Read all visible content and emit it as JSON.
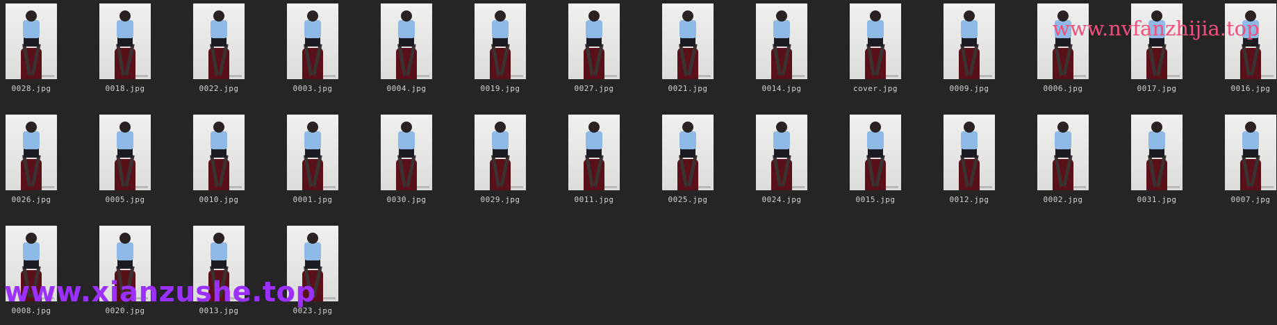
{
  "files": [
    {
      "name": "0028.jpg"
    },
    {
      "name": "0018.jpg"
    },
    {
      "name": "0022.jpg"
    },
    {
      "name": "0003.jpg"
    },
    {
      "name": "0004.jpg"
    },
    {
      "name": "0019.jpg"
    },
    {
      "name": "0027.jpg"
    },
    {
      "name": "0021.jpg"
    },
    {
      "name": "0014.jpg"
    },
    {
      "name": "cover.jpg"
    },
    {
      "name": "0009.jpg"
    },
    {
      "name": "0006.jpg"
    },
    {
      "name": "0017.jpg"
    },
    {
      "name": "0016.jpg"
    },
    {
      "name": "0026.jpg"
    },
    {
      "name": "0005.jpg"
    },
    {
      "name": "0010.jpg"
    },
    {
      "name": "0001.jpg"
    },
    {
      "name": "0030.jpg"
    },
    {
      "name": "0029.jpg"
    },
    {
      "name": "0011.jpg"
    },
    {
      "name": "0025.jpg"
    },
    {
      "name": "0024.jpg"
    },
    {
      "name": "0015.jpg"
    },
    {
      "name": "0012.jpg"
    },
    {
      "name": "0002.jpg"
    },
    {
      "name": "0031.jpg"
    },
    {
      "name": "0007.jpg"
    },
    {
      "name": "0008.jpg"
    },
    {
      "name": "0020.jpg"
    },
    {
      "name": "0013.jpg"
    },
    {
      "name": "0023.jpg"
    }
  ],
  "watermarks": {
    "top_right": "www.nvfanzhijia.top",
    "bottom_left": "www.xianzushe.top"
  }
}
